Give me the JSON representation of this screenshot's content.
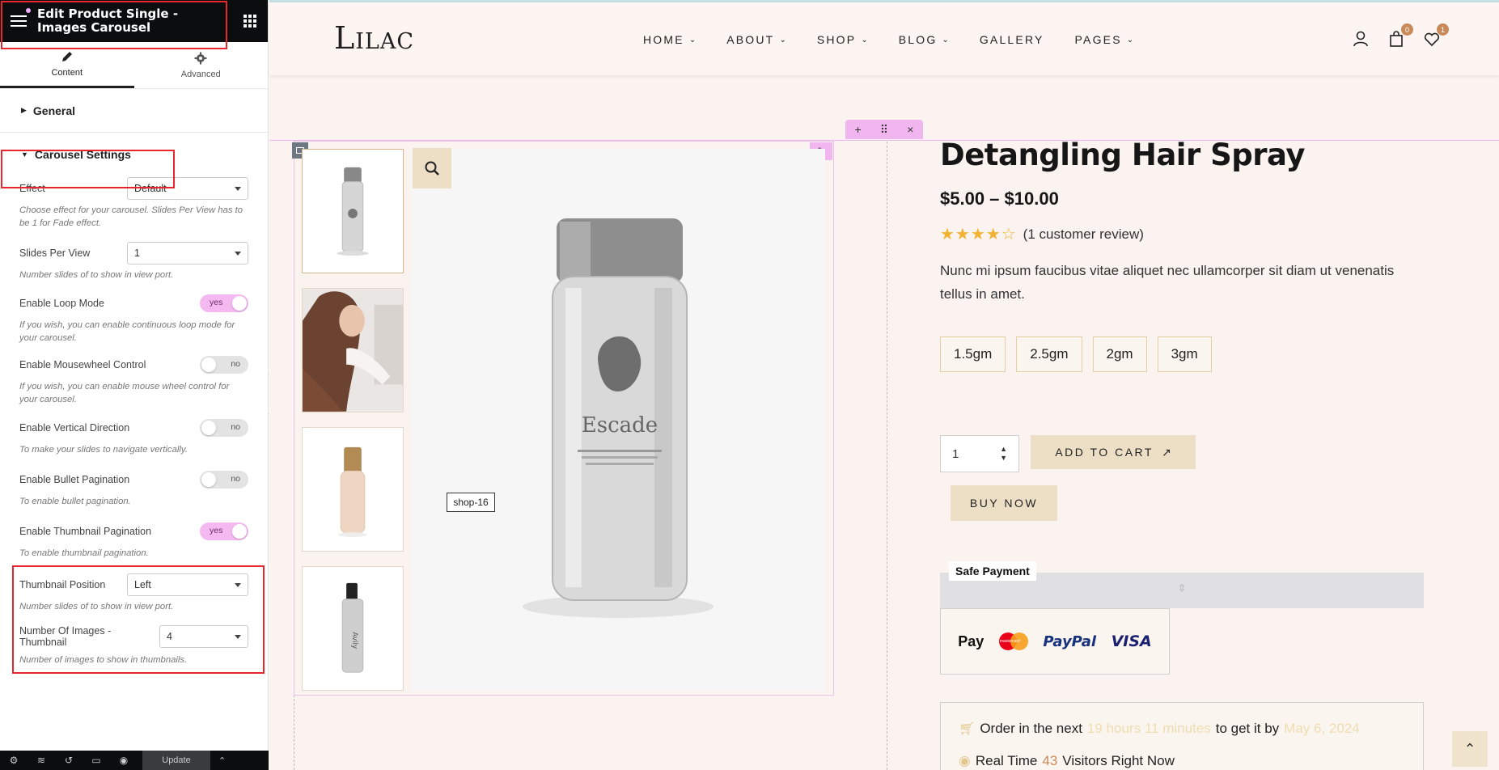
{
  "editor": {
    "title": "Edit Product Single - Images Carousel",
    "tabs": [
      {
        "label": "Content",
        "active": true
      },
      {
        "label": "Advanced",
        "active": false
      }
    ],
    "sections": {
      "general": "General",
      "carousel": "Carousel Settings"
    },
    "controls": {
      "effect": {
        "label": "Effect",
        "value": "Default",
        "desc": "Choose effect for your carousel. Slides Per View has to be 1 for Fade effect."
      },
      "slides_per_view": {
        "label": "Slides Per View",
        "value": "1",
        "desc": "Number slides of to show in view port."
      },
      "loop": {
        "label": "Enable Loop Mode",
        "state": "yes",
        "desc": "If you wish, you can enable continuous loop mode for your carousel."
      },
      "mousewheel": {
        "label": "Enable Mousewheel Control",
        "state": "no",
        "desc": "If you wish, you can enable mouse wheel control for your carousel."
      },
      "vertical": {
        "label": "Enable Vertical Direction",
        "state": "no",
        "desc": "To make your slides to navigate vertically."
      },
      "bullet": {
        "label": "Enable Bullet Pagination",
        "state": "no",
        "desc": "To enable bullet pagination."
      },
      "thumbnail": {
        "label": "Enable Thumbnail Pagination",
        "state": "yes",
        "desc": "To enable thumbnail pagination."
      },
      "thumb_position": {
        "label": "Thumbnail Position",
        "value": "Left",
        "desc": "Number slides of to show in view port."
      },
      "num_images": {
        "label": "Number Of Images - Thumbnail",
        "value": "4",
        "desc": "Number of images to show in thumbnails."
      }
    },
    "footer": {
      "update_label": "Update"
    }
  },
  "site": {
    "logo": "Lilac",
    "nav": [
      {
        "label": "HOME",
        "dropdown": true
      },
      {
        "label": "ABOUT",
        "dropdown": true
      },
      {
        "label": "SHOP",
        "dropdown": true
      },
      {
        "label": "BLOG",
        "dropdown": true
      },
      {
        "label": "GALLERY",
        "dropdown": false
      },
      {
        "label": "PAGES",
        "dropdown": true
      }
    ],
    "cart_count": "0",
    "wishlist_count": "1",
    "accent": "#f1b5ef",
    "button_color": "#ecdfc6"
  },
  "product": {
    "title": "Detangling Hair Spray",
    "price": "$5.00 – $10.00",
    "rating": 4,
    "review_text": "(1 customer review)",
    "description": "Nunc mi ipsum faucibus vitae aliquet nec ullamcorper sit diam ut venenatis tellus in amet.",
    "sizes": [
      "1.5gm",
      "2.5gm",
      "2gm",
      "3gm"
    ],
    "qty": "1",
    "add_to_cart": "ADD TO CART",
    "buy_now": "BUY NOW",
    "image_tooltip": "shop-16",
    "bottle_brand": "Escade",
    "thumb_brand": "Avily",
    "safe_payment": "Safe Payment",
    "payment_methods": [
      "Pay",
      "PayPal",
      "VISA"
    ],
    "mastercard_text": "mastercard",
    "order": {
      "prefix": "Order in the next",
      "time": "19 hours 11 minutes",
      "middle": "to get it by",
      "date": "May 6, 2024"
    },
    "visitors": {
      "prefix": "Real Time",
      "count": "43",
      "suffix": "Visitors Right Now"
    }
  }
}
